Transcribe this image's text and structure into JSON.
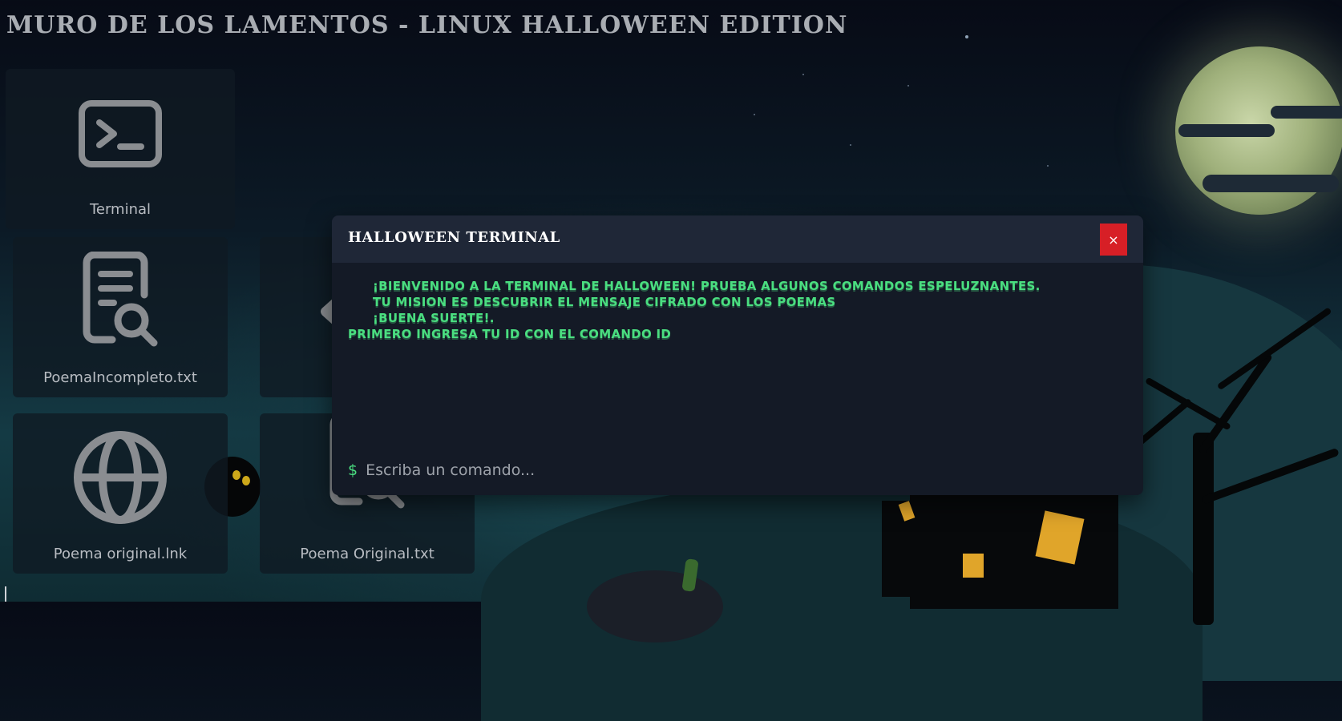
{
  "page": {
    "title": "MURO DE LOS LAMENTOS - LINUX HALLOWEEN EDITION"
  },
  "desktop": {
    "icons": [
      {
        "label": "Terminal",
        "icon": "terminal-icon"
      },
      {
        "label": "PoemaIncompleto.txt",
        "icon": "file-search-icon"
      },
      {
        "label": "Poema original.lnk",
        "icon": "globe-icon"
      },
      {
        "label": "Poema Original.txt",
        "icon": "file-search-icon"
      }
    ]
  },
  "terminal": {
    "title": "HALLOWEEN TERMINAL",
    "close_label": "×",
    "lines": [
      "¡BIENVENIDO A LA TERMINAL DE HALLOWEEN! PRUEBA ALGUNOS COMANDOS ESPELUZNANTES.",
      "TU MISION ES DESCUBRIR EL MENSAJE CIFRADO CON LOS POEMAS",
      "¡BUENA SUERTE!.",
      "PRIMERO INGRESA TU ID CON EL COMANDO ID"
    ],
    "prompt_symbol": "$",
    "input_placeholder": "Escriba un comando...",
    "input_value": ""
  },
  "colors": {
    "accent_green": "#4ade80",
    "close_red": "#d71f26",
    "modal_bg": "#141a26",
    "modal_header_bg": "#1f2737"
  }
}
